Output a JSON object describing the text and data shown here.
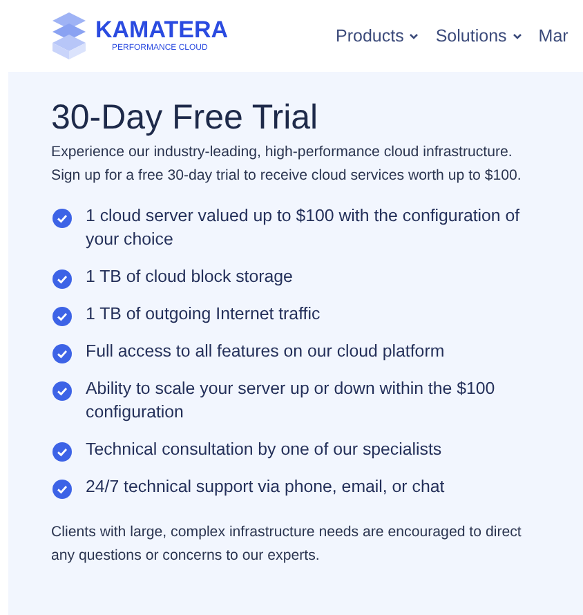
{
  "logo": {
    "name": "KAMATERA",
    "tagline": "PERFORMANCE CLOUD"
  },
  "nav": [
    {
      "label": "Products",
      "dropdown": true
    },
    {
      "label": "Solutions",
      "dropdown": true
    },
    {
      "label": "Mar",
      "dropdown": false
    }
  ],
  "title": "30-Day Free Trial",
  "intro": "Experience our industry-leading, high-performance cloud infrastructure. Sign up for a free 30-day trial to receive cloud services worth up to $100.",
  "features": [
    "1 cloud server valued up to $100 with the configuration of your choice",
    "1 TB of cloud block storage",
    "1 TB of outgoing Internet traffic",
    "Full access to all features on our cloud platform",
    "Ability to scale your server up or down within the $100 configuration",
    "Technical consultation by one of our specialists",
    "24/7 technical support via phone, email, or chat"
  ],
  "note": "Clients with large, complex infrastructure needs are encouraged to direct any questions or concerns to our experts."
}
